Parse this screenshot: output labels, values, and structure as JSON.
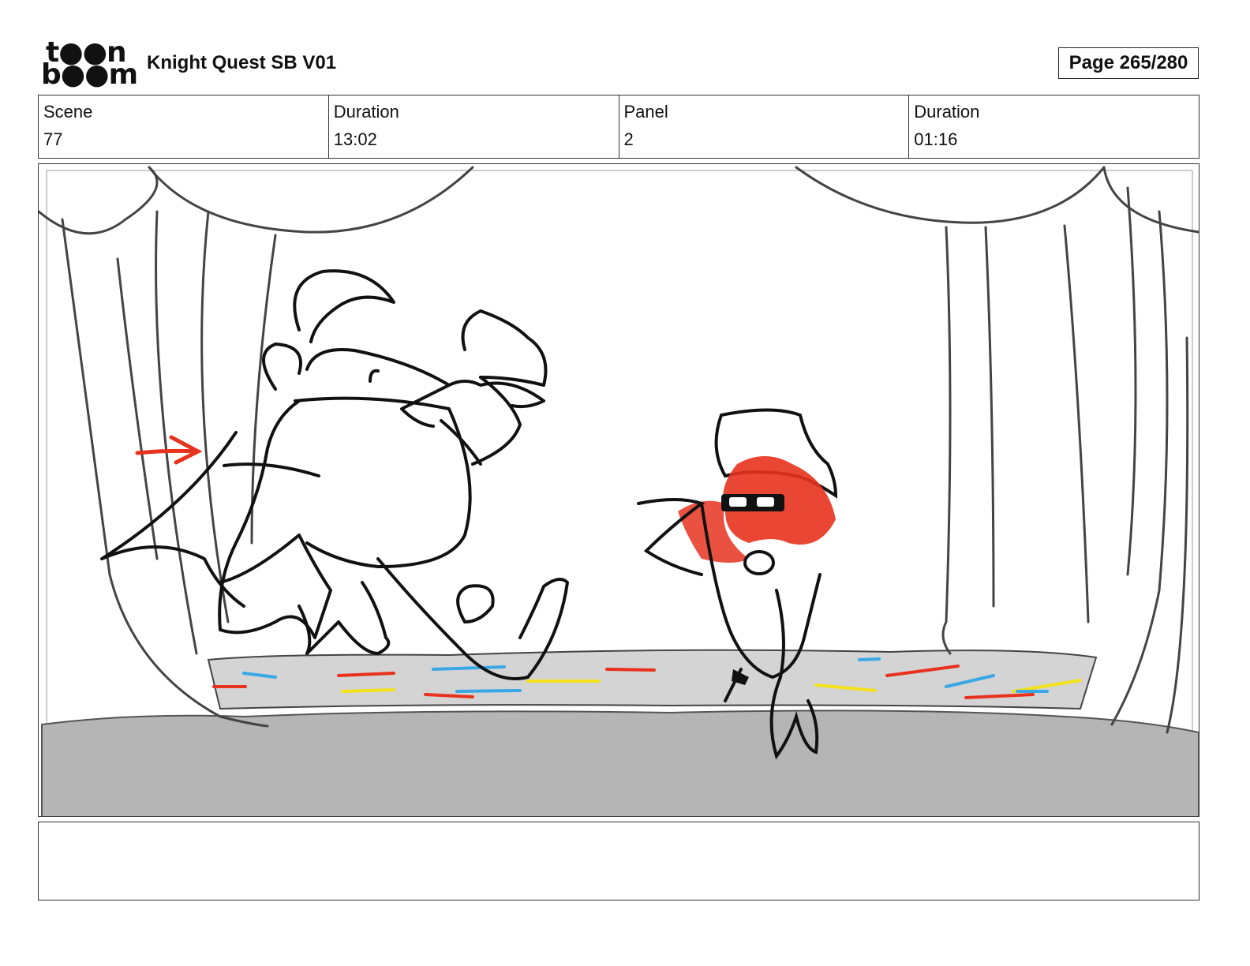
{
  "header": {
    "logo_line1": "t●●n",
    "logo_line2": "b●●m",
    "project_title": "Knight Quest SB V01",
    "page_label": "Page 265/280"
  },
  "info": {
    "scene_label": "Scene",
    "scene_value": "77",
    "scene_duration_label": "Duration",
    "scene_duration_value": "13:02",
    "panel_label": "Panel",
    "panel_value": "2",
    "panel_duration_label": "Duration",
    "panel_duration_value": "01:16"
  },
  "panel": {
    "description_icons": [
      "stage-curtains",
      "knight-character",
      "small-character",
      "motion-arrow"
    ],
    "colors": {
      "stage_gray": "#b5b5b5",
      "floor_gray": "#d4d4d4",
      "accent_red": "#e8321e",
      "accent_blue": "#3aa8e6",
      "accent_yellow": "#f3e21b"
    }
  },
  "notes": {
    "text": ""
  }
}
